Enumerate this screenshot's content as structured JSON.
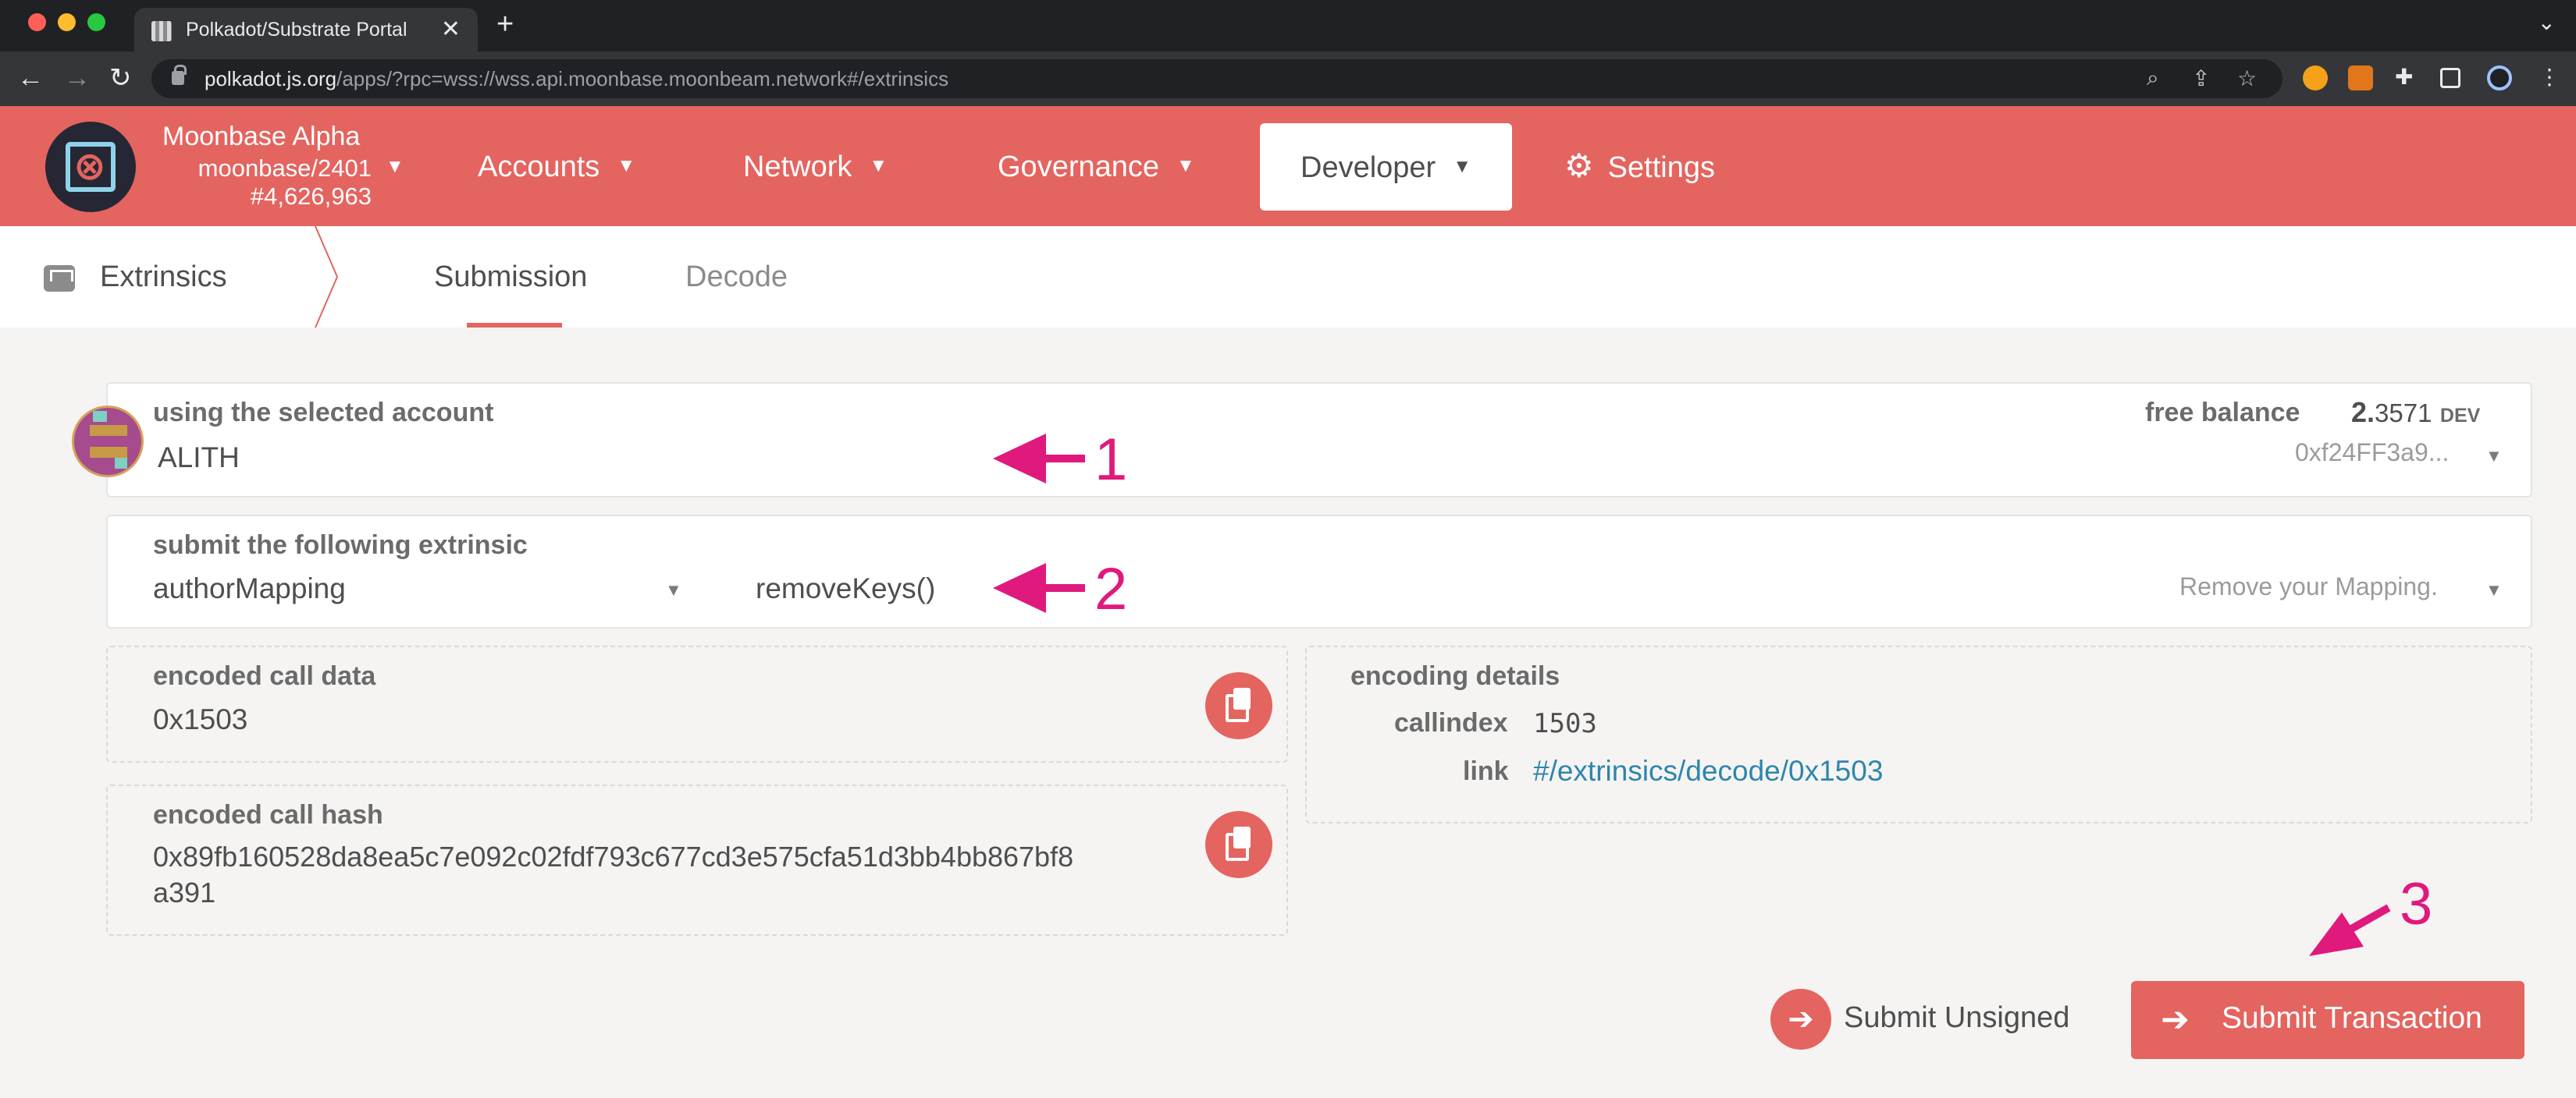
{
  "browser": {
    "tab_title": "Polkadot/Substrate Portal",
    "tab_close": "✕",
    "new_tab": "+",
    "url_host": "polkadot.js.org",
    "url_rest": "/apps/?rpc=wss://wss.api.moonbase.moonbeam.network#/extrinsics"
  },
  "chain": {
    "name": "Moonbase Alpha",
    "spec": "moonbase/2401",
    "block": "#4,626,963"
  },
  "nav": {
    "accounts": "Accounts",
    "network": "Network",
    "governance": "Governance",
    "developer": "Developer",
    "settings": "Settings"
  },
  "subnav": {
    "title": "Extrinsics",
    "tab_submission": "Submission",
    "tab_decode": "Decode"
  },
  "account": {
    "label": "using the selected account",
    "name": "ALITH",
    "balance_label": "free balance",
    "balance_int": "2.",
    "balance_dec": "3571",
    "balance_unit": "DEV",
    "address": "0xf24FF3a9..."
  },
  "extrinsic": {
    "label": "submit the following extrinsic",
    "module": "authorMapping",
    "method": "removeKeys()",
    "description": "Remove your Mapping."
  },
  "call_data": {
    "label": "encoded call data",
    "value": "0x1503"
  },
  "encoding": {
    "label": "encoding details",
    "callindex_label": "callindex",
    "callindex_value": "1503",
    "link_label": "link",
    "link_value": "#/extrinsics/decode/0x1503"
  },
  "call_hash": {
    "label": "encoded call hash",
    "line1": "0x89fb160528da8ea5c7e092c02fdf793c677cd3e575cfa51d3bb4bb867bf8",
    "line2": "a391"
  },
  "actions": {
    "unsigned": "Submit Unsigned",
    "submit": "Submit Transaction"
  },
  "annotations": [
    "1",
    "2",
    "3"
  ],
  "colors": {
    "accent": "#e4645f",
    "annotation": "#e0197d",
    "link": "#2e86ab"
  }
}
